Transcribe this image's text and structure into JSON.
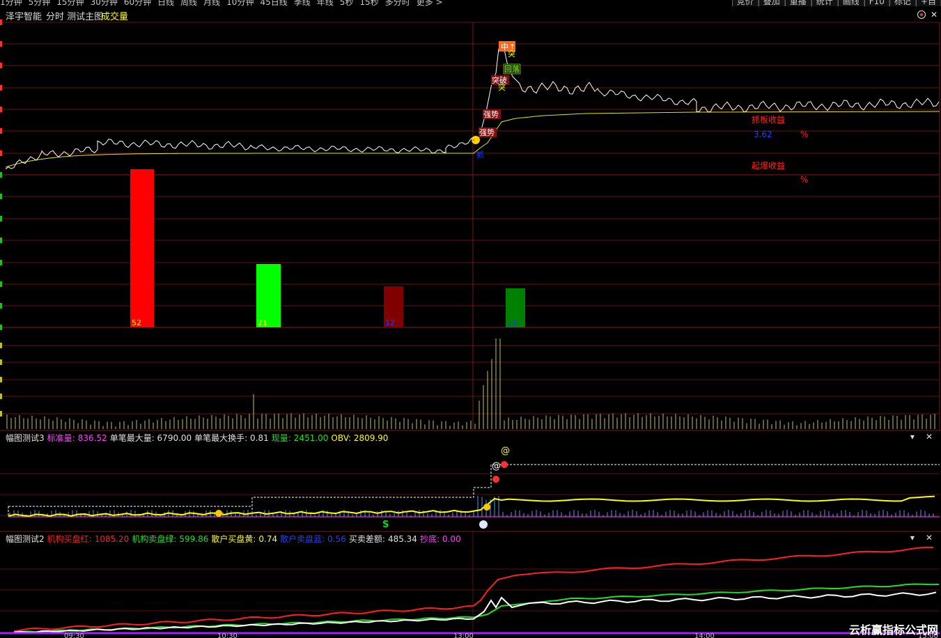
{
  "toolbar": {
    "periods": [
      "1分钟",
      "5分钟",
      "15分钟",
      "30分钟",
      "60分钟",
      "日线",
      "周线",
      "月线",
      "10分钟",
      "45日线",
      "季线",
      "年线",
      "5秒",
      "15秒",
      "多分时",
      "更多 >"
    ],
    "tools": [
      "竞价",
      "叠加",
      "重播",
      "统计",
      "画线",
      "F10",
      "标记",
      "+自"
    ]
  },
  "title_bar": {
    "app": "泽宇智能",
    "view": "分时 测试主图",
    "volume_label": "成交量",
    "icons": [
      "target-icon",
      "close-icon"
    ]
  },
  "main_chart": {
    "annotations": {
      "zhong": "中",
      "arrow": "↑",
      "tu": "突",
      "huiluo": "回落",
      "tupo": "突破",
      "qiangshi": "强势",
      "zhuo": "抓"
    },
    "zhuaban_label": "抓板收益",
    "zhuaban_value": "3.62",
    "zhuaban_pct": "%",
    "qibao_label": "起爆收益",
    "qibao_pct": "%"
  },
  "bars": [
    {
      "value": 52,
      "color": "#ff0000"
    },
    {
      "value": 21,
      "color": "#00ff00"
    },
    {
      "value": 12,
      "color": "#800000"
    },
    {
      "value": 13,
      "color": "#008000"
    }
  ],
  "panel3": {
    "name": "幅图测试3",
    "std_label": "标准量:",
    "std_value": "836.52",
    "max_single": "单笔最大量: 6790.00",
    "max_turnover": "单笔最大换手: 0.81",
    "cur_label": "现量:",
    "cur_value": "2451.00",
    "obv": "OBV: 2809.90",
    "markers": [
      "@",
      "@",
      "S"
    ]
  },
  "panel2": {
    "name": "幅图测试2",
    "inst_buy_label": "机构买盘红:",
    "inst_buy": "1085.20",
    "inst_sell_label": "机构卖盘绿:",
    "inst_sell": "599.86",
    "retail_buy_label": "散户买盘黄:",
    "retail_buy": "0.74",
    "retail_sell_label": "散户卖盘蓝:",
    "retail_sell": "0.56",
    "diff_label": "买卖差额:",
    "diff": "485.34",
    "bottom_label": "抄底:",
    "bottom": "0.00"
  },
  "time_axis": [
    "09:30",
    "10:30",
    "13:00",
    "14:00",
    "15:00"
  ],
  "watermark": "云析赢指标公式网"
}
